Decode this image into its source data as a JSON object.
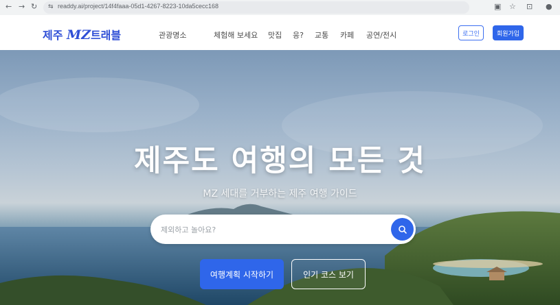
{
  "browser": {
    "url": "readdy.ai/project/14f4faaa-05d1-4267-8223-10da5cecc168"
  },
  "nav": {
    "logo_prefix": "제주",
    "logo_mz": "MZ",
    "logo_suffix": "트래블",
    "menu": [
      "관광명소",
      "체험해 보세요",
      "맛집",
      "응?",
      "교통",
      "카페",
      "공연/전시"
    ],
    "login": "로그인",
    "signup": "회원가입"
  },
  "hero": {
    "title": "제주도 여행의 모든 것",
    "subtitle": "MZ 세대를 거부하는 제주 여행 가이드",
    "search_placeholder": "제외하고 놀아요?",
    "cta_primary": "여행계획 시작하기",
    "cta_secondary": "인기 코스 보기"
  },
  "colors": {
    "brand": "#2f66ea",
    "logo": "#2f4fd6"
  }
}
